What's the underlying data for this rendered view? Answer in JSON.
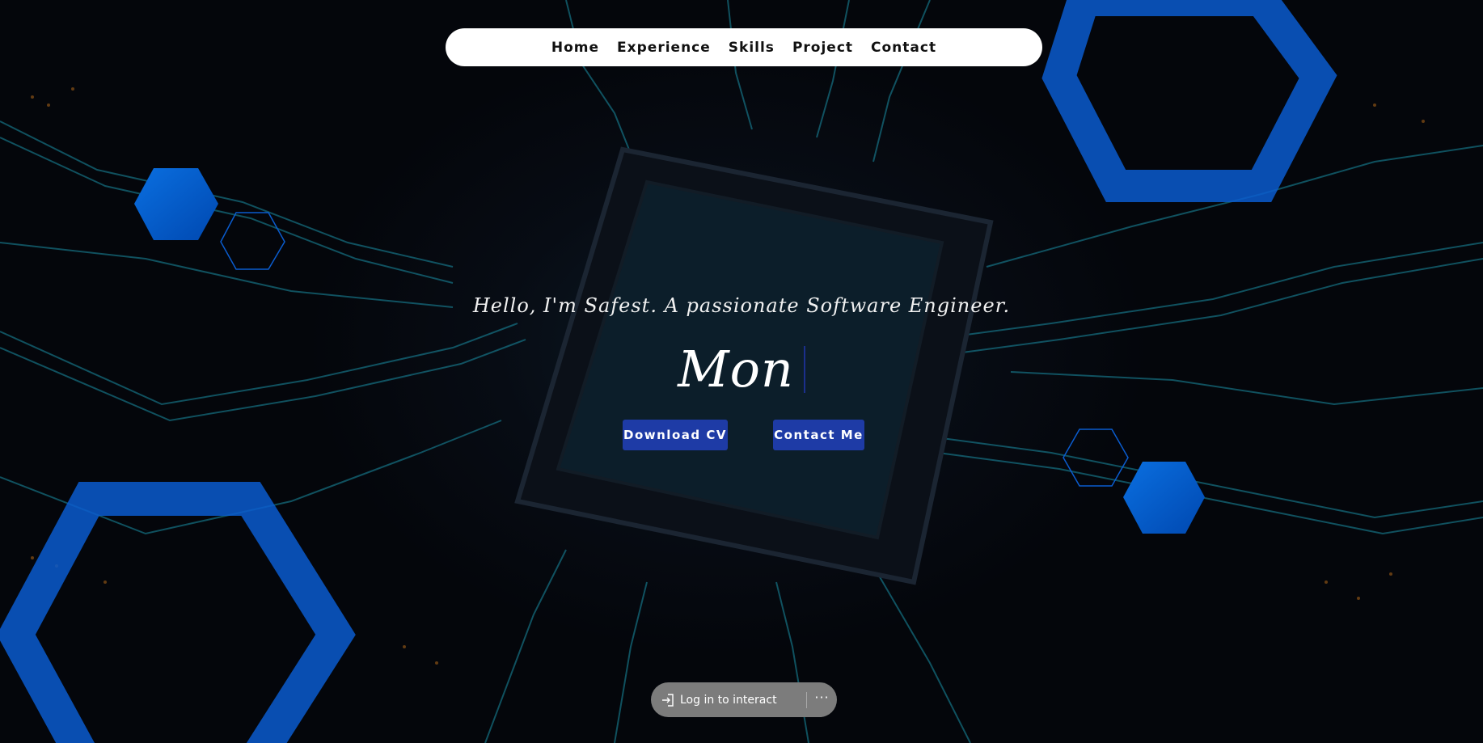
{
  "nav": {
    "links": [
      {
        "label": "Home"
      },
      {
        "label": "Experience"
      },
      {
        "label": "Skills"
      },
      {
        "label": "Project"
      },
      {
        "label": "Contact"
      }
    ]
  },
  "hero": {
    "tagline": "Hello, I'm Safest. A passionate Software Engineer.",
    "typed_text": "Mon",
    "download_cv_label": "Download CV",
    "contact_me_label": "Contact Me"
  },
  "login_bar": {
    "label": "Log in to interact",
    "more_label": "···"
  },
  "colors": {
    "accent_blue": "#0062d6",
    "button_blue": "#1e3ba6",
    "nav_background": "#ffffff",
    "circuit_trace": "#1fa3b8"
  },
  "icons": {
    "login": "login-icon",
    "more": "more-dots-icon"
  }
}
